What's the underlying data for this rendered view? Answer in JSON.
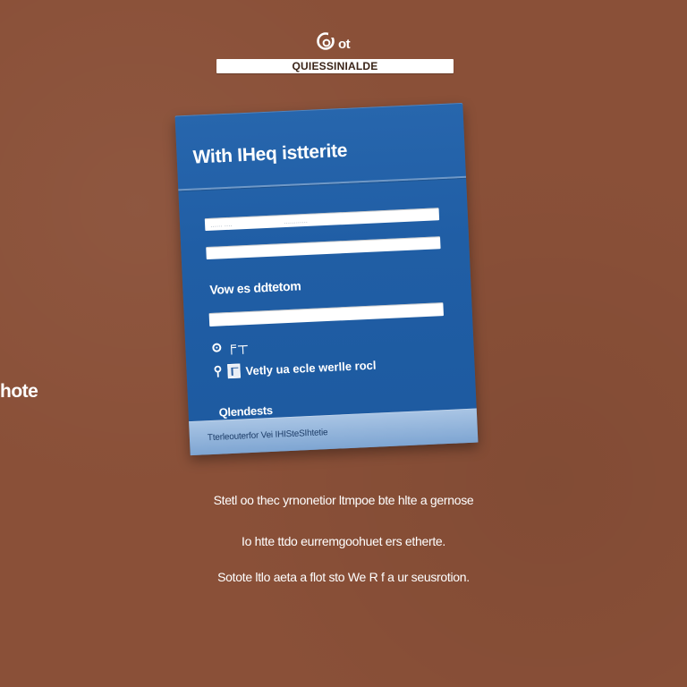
{
  "brand": {
    "text": "ot",
    "icon": "logo-c-icon"
  },
  "banner": {
    "text": "QUIESSINIALDE"
  },
  "side_text": "hote",
  "card": {
    "title": "With IHeq istterite",
    "fields": {
      "field1_placeholder": "...... ....                          ............",
      "field2_placeholder": "",
      "field3_placeholder": ""
    },
    "section_label": "Vow es ddtetom",
    "options": {
      "row1_glyph": "╒ ┬",
      "row2_label": "Vetly ua ecle werlle rocl"
    },
    "footer_label": "Qlendests",
    "footer_text": "Tterleouterfor Vei IHISteSIhtetie"
  },
  "bottom": {
    "line1": "Stetl oo thec yrnonetior ltmpoe bte hlte a gernose",
    "line2": "Io htte ttdo eurremgoohuet ers etherte.",
    "line3": "Sotote ltlo aeta a flot sto We R f a ur seusrotion."
  },
  "colors": {
    "background": "#8a5038",
    "card_blue": "#2262a8",
    "card_footer": "#94b6dc"
  }
}
